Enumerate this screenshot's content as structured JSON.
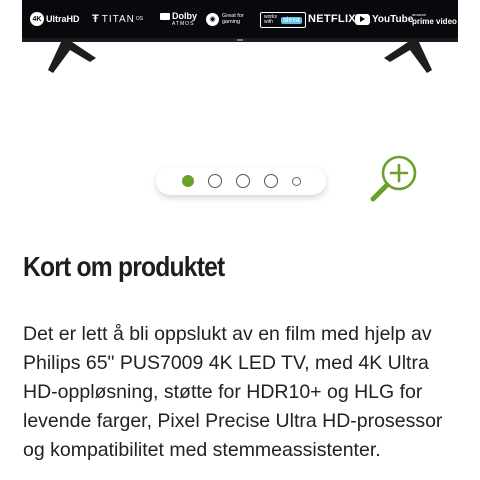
{
  "product_image": {
    "badges": {
      "uhd": {
        "mark": "4K",
        "text": "UltraHD"
      },
      "titan": {
        "text": "TITAN",
        "sup": "OS"
      },
      "dolby": {
        "top": "Dolby",
        "bottom": "ATMOS"
      },
      "gaming": {
        "text": "Great for gaming"
      },
      "alexa": {
        "works": "works with",
        "alexa": "alexa"
      },
      "netflix": {
        "text": "NETFLIX"
      },
      "youtube": {
        "text": "YouTube"
      },
      "prime": {
        "top": "amazon",
        "text": "prime video"
      }
    },
    "colors": {
      "screen": "#07090c",
      "stand": "#1a1a1a"
    }
  },
  "carousel": {
    "slide_count": 5,
    "active_index": 0,
    "active_color": "#6ca02d"
  },
  "zoom": {
    "icon": "zoom-in-icon",
    "color": "#6ca02d"
  },
  "section": {
    "heading": "Kort om produktet",
    "description": "Det er lett å bli oppslukt av en film med hjelp av Philips 65\" PUS7009 4K LED TV, med 4K Ultra HD-oppløsning, støtte for HDR10+ og HLG for levende farger, Pixel Precise Ultra HD-prosessor og kompatibilitet med stemmeassistenter."
  }
}
